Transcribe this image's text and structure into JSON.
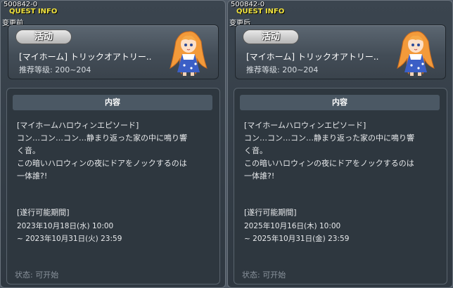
{
  "panels": [
    {
      "quest_id": "500842-0",
      "quest_info": "QUEST INFO",
      "state_label": "变更前",
      "badge": "活动",
      "quest_name": "[マイホーム] トリックオアトリー..",
      "level": "推荐等级: 200~204",
      "content_title": "内容",
      "body_lines": [
        "[マイホームハロウィンエピソード]",
        "コン…コン…コン…静まり返った家の中に鳴り響",
        "く音。",
        "この暗いハロウィンの夜にドアをノックするのは",
        "一体誰?!"
      ],
      "period_label": "[遂行可能期間]",
      "period_start": "2023年10月18日(水) 10:00",
      "period_end": "~ 2023年10月31日(火) 23:59",
      "status": "状态:  可开始"
    },
    {
      "quest_id": "500842-0",
      "quest_info": "QUEST INFO",
      "state_label": "变更后",
      "badge": "活动",
      "quest_name": "[マイホーム] トリックオアトリー..",
      "level": "推荐等级: 200~204",
      "content_title": "内容",
      "body_lines": [
        "[マイホームハロウィンエピソード]",
        "コン…コン…コン…静まり返った家の中に鳴り響",
        "く音。",
        "この暗いハロウィンの夜にドアをノックするのは",
        "一体誰?!"
      ],
      "period_label": "[遂行可能期間]",
      "period_start": "2025年10月16日(木) 10:00",
      "period_end": "~ 2025年10月31日(金) 23:59",
      "status": "状态:  可开始"
    }
  ],
  "icons": {
    "avatar": "npc-avatar-icon"
  },
  "colors": {
    "quest_info": "#f0e23c",
    "accent_hair": "#f39a3a",
    "dress": "#3b5fc6"
  }
}
